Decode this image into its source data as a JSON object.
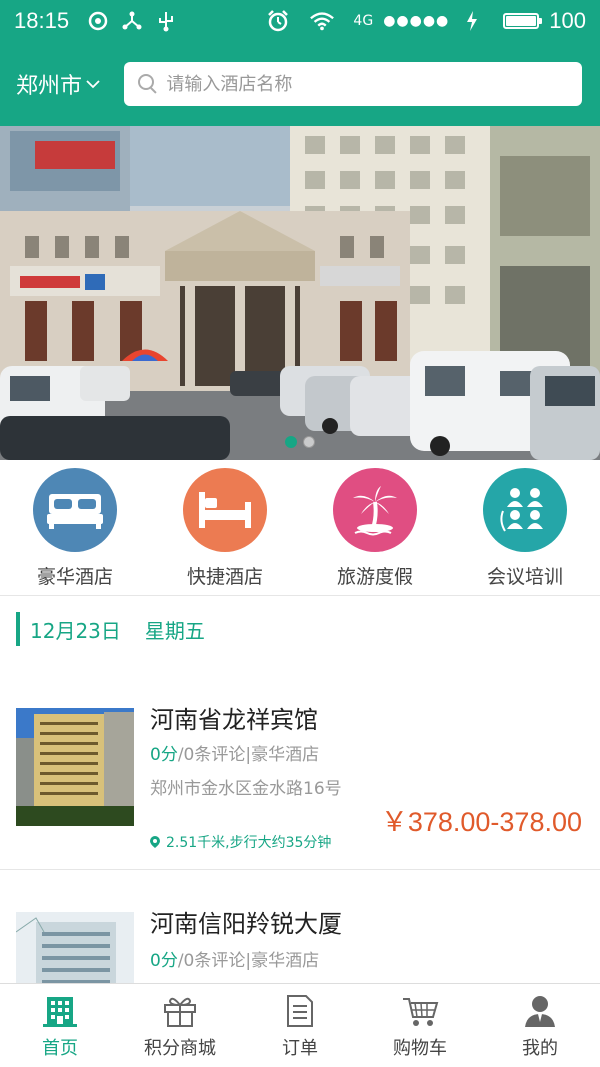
{
  "status_bar": {
    "time": "18:15",
    "network": "4G",
    "signal_dots": "●●●●●",
    "battery": "100",
    "battery_level": 1.0
  },
  "header": {
    "city": "郑州市",
    "search_placeholder": "请输入酒店名称"
  },
  "banner": {
    "total_slides": 2,
    "active_slide": 1
  },
  "categories": [
    {
      "label": "豪华酒店",
      "icon": "bed-icon",
      "color": "#4e87b5"
    },
    {
      "label": "快捷酒店",
      "icon": "single-bed-icon",
      "color": "#ec7b52"
    },
    {
      "label": "旅游度假",
      "icon": "palm-tree-icon",
      "color": "#e04e82"
    },
    {
      "label": "会议培训",
      "icon": "meeting-icon",
      "color": "#25a6a8"
    }
  ],
  "date": {
    "day": "12月23日",
    "weekday": "星期五"
  },
  "hotels": [
    {
      "name": "河南省龙祥宾馆",
      "score": "0分",
      "meta_rest": "/0条评论|豪华酒店",
      "address": "郑州市金水区金水路16号",
      "price": "￥378.00-378.00",
      "distance": "2.51千米,步行大约35分钟"
    },
    {
      "name": "河南信阳羚锐大厦",
      "score": "0分",
      "meta_rest": "/0条评论|豪华酒店"
    }
  ],
  "tabs": [
    {
      "label": "首页",
      "icon": "building-icon",
      "active": true
    },
    {
      "label": "积分商城",
      "icon": "gift-icon",
      "active": false
    },
    {
      "label": "订单",
      "icon": "document-icon",
      "active": false
    },
    {
      "label": "购物车",
      "icon": "cart-icon",
      "active": false
    },
    {
      "label": "我的",
      "icon": "user-icon",
      "active": false
    }
  ],
  "colors": {
    "primary": "#17a685",
    "price": "#e05a2b"
  }
}
